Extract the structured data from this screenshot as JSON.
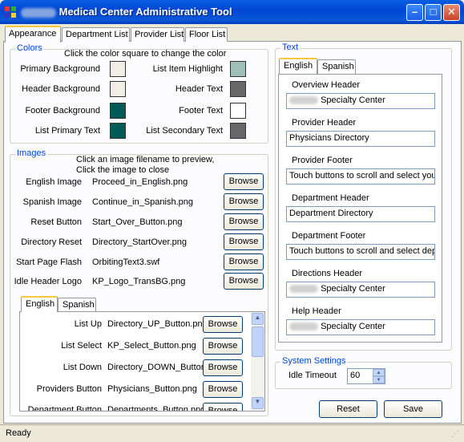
{
  "window": {
    "title": "Medical Center Administrative Tool",
    "minimize_glyph": "–",
    "maximize_glyph": "□",
    "close_glyph": "✕"
  },
  "main_tabs": [
    "Appearance",
    "Department List",
    "Provider List",
    "Floor List"
  ],
  "colors_group": {
    "title": "Colors",
    "hint": "Click the color square to change the color",
    "items": [
      {
        "label": "Primary Background",
        "color": "#f2ede6"
      },
      {
        "label": "Header Background",
        "color": "#f2ede6"
      },
      {
        "label": "Footer Background",
        "color": "#005a55"
      },
      {
        "label": "List Primary Text",
        "color": "#005a55"
      },
      {
        "label": "List Item Highlight",
        "color": "#9fbfb7"
      },
      {
        "label": "Header Text",
        "color": "#676767"
      },
      {
        "label": "Footer Text",
        "color": "#ffffff"
      },
      {
        "label": "List Secondary Text",
        "color": "#676767"
      }
    ]
  },
  "images_group": {
    "title": "Images",
    "hint1": "Click an image filename to preview,",
    "hint2": "Click the image to close",
    "browse_label": "Browse",
    "items": [
      {
        "label": "English Image",
        "file": "Proceed_in_English.png"
      },
      {
        "label": "Spanish Image",
        "file": "Continue_in_Spanish.png"
      },
      {
        "label": "Reset Button",
        "file": "Start_Over_Button.png"
      },
      {
        "label": "Directory Reset",
        "file": "Directory_StartOver.png"
      },
      {
        "label": "Start Page Flash",
        "file": "OrbitingText3.swf"
      },
      {
        "label": "Idle Header Logo",
        "file": "KP_Logo_TransBG.png"
      }
    ],
    "lang_tabs": [
      "English",
      "Spanish"
    ],
    "lang_items": [
      {
        "label": "List Up",
        "file": "Directory_UP_Button.png"
      },
      {
        "label": "List Select",
        "file": "KP_Select_Button.png"
      },
      {
        "label": "List Down",
        "file": "Directory_DOWN_Button"
      },
      {
        "label": "Providers Button",
        "file": "Physicians_Button.png"
      },
      {
        "label": "Department Button",
        "file": "Departments_Button.png"
      }
    ]
  },
  "text_group": {
    "title": "Text",
    "lang_tabs": [
      "English",
      "Spanish"
    ],
    "fields": [
      {
        "label": "Overview Header",
        "value": "Specialty Center"
      },
      {
        "label": "Provider Header",
        "value": "Physicians Directory"
      },
      {
        "label": "Provider Footer",
        "value": "Touch buttons to scroll and select your"
      },
      {
        "label": "Department Header",
        "value": "Department Directory"
      },
      {
        "label": "Department Footer",
        "value": "Touch buttons to scroll and select dep"
      },
      {
        "label": "Directions Header",
        "value": "Specialty Center"
      },
      {
        "label": "Help Header",
        "value": "Specialty Center"
      }
    ]
  },
  "system_settings": {
    "title": "System Settings",
    "idle_timeout_label": "Idle Timeout",
    "idle_timeout_value": "60"
  },
  "buttons": {
    "reset": "Reset",
    "save": "Save"
  },
  "status": "Ready"
}
